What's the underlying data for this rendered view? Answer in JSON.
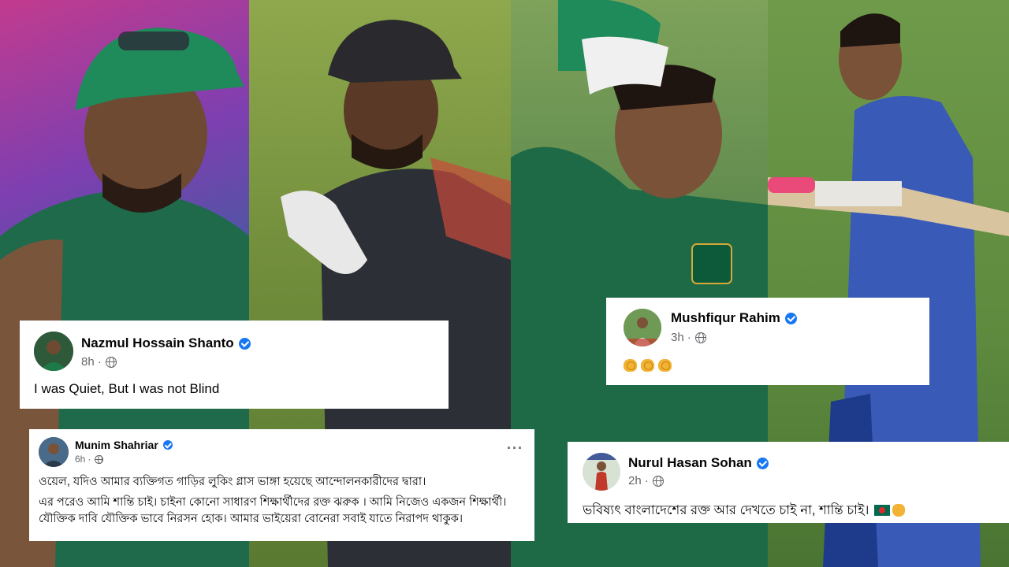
{
  "photos": [
    {
      "subject": "player-green-cap"
    },
    {
      "subject": "player-black-cap"
    },
    {
      "subject": "player-hand-on-head"
    },
    {
      "subject": "player-blue-kit-bats"
    }
  ],
  "posts": [
    {
      "author": "Nazmul Hossain Shanto",
      "time": "8h",
      "separator": "·",
      "text": "I was Quiet, But I was not Blind"
    },
    {
      "author": "Munim Shahriar",
      "time": "6h",
      "separator": "·",
      "menu": "···",
      "text_line1": "ওয়েল, যদিও আমার ব্যক্তিগত গাড়ির লুকিং গ্লাস ভাঙ্গা হয়েছে আন্দোলনকারীদের দ্বারা।",
      "text_para2": "এর পরেও আমি শান্তি চাই। চাইনা কোনো সাধারণ শিক্ষার্থীদের রক্ত ঝরুক । আমি নিজেও একজন শিক্ষার্থী। যৌক্তিক দাবি যৌক্তিক ভাবে নিরসন হোক। আমার ভাইয়েরা বোনেরা সবাই যাতে নিরাপদ থাকুক।"
    },
    {
      "author": "Mushfiqur Rahim",
      "time": "3h",
      "separator": "·",
      "emoji": [
        "clapping-hands",
        "clapping-hands",
        "clapping-hands"
      ]
    },
    {
      "author": "Nurul Hasan Sohan",
      "time": "2h",
      "separator": "·",
      "text": "ভবিষ্যৎ বাংলাদেশের রক্ত আর দেখতে চাই না, শান্তি চাই।",
      "emoji": [
        "bangladesh-flag",
        "raised-fist"
      ]
    }
  ],
  "colors": {
    "verified": "#1877f2",
    "meta": "#65676b",
    "card": "#ffffff",
    "text": "#050505"
  }
}
